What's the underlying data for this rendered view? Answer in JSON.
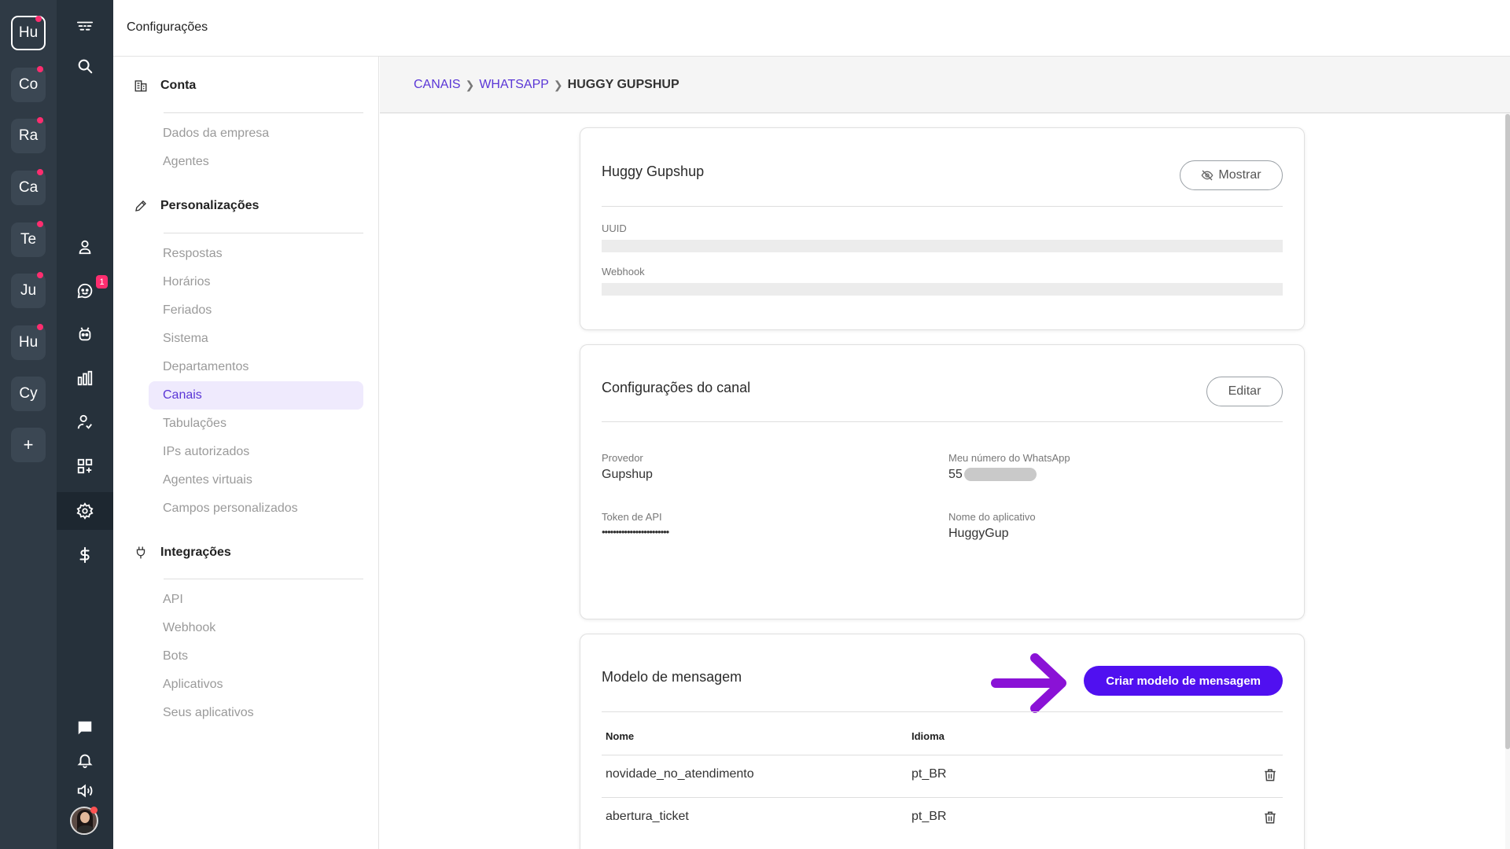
{
  "workspaces": [
    {
      "label": "Hu",
      "active": true
    },
    {
      "label": "Co"
    },
    {
      "label": "Ra"
    },
    {
      "label": "Ca"
    },
    {
      "label": "Te"
    },
    {
      "label": "Ju"
    },
    {
      "label": "Hu"
    },
    {
      "label": "Cy"
    },
    {
      "label": "+"
    }
  ],
  "nav": {
    "chat_badge": "1",
    "icons": [
      "logo-icon",
      "search-icon",
      "contacts-icon",
      "chat-icon",
      "bot-icon",
      "reports-icon",
      "agents-icon",
      "apps-icon",
      "settings-icon",
      "billing-icon",
      "messages-icon",
      "bell-icon",
      "sound-icon"
    ]
  },
  "topbar": {
    "title": "Configurações"
  },
  "sidebar": {
    "sections": [
      {
        "title": "Conta",
        "icon": "building-icon",
        "items": [
          "Dados da empresa",
          "Agentes"
        ]
      },
      {
        "title": "Personalizações",
        "icon": "pencil-icon",
        "items": [
          "Respostas",
          "Horários",
          "Feriados",
          "Sistema",
          "Departamentos",
          "Canais",
          "Tabulações",
          "IPs autorizados",
          "Agentes virtuais",
          "Campos personalizados"
        ]
      },
      {
        "title": "Integrações",
        "icon": "plug-icon",
        "items": [
          "API",
          "Webhook",
          "Bots",
          "Aplicativos",
          "Seus aplicativos"
        ]
      }
    ],
    "active_item": "Canais"
  },
  "breadcrumb": {
    "items": [
      "CANAIS",
      "WHATSAPP"
    ],
    "current": "HUGGY GUPSHUP"
  },
  "channel_card": {
    "title": "Huggy Gupshup",
    "show_button": "Mostrar",
    "uuid_label": "UUID",
    "webhook_label": "Webhook"
  },
  "config_card": {
    "title": "Configurações do canal",
    "edit_button": "Editar",
    "provider_label": "Provedor",
    "provider_value": "Gupshup",
    "whatsapp_label": "Meu número do WhatsApp",
    "whatsapp_value": "55",
    "token_label": "Token de API",
    "token_value": "••••••••••••••••••••••••",
    "app_label": "Nome do aplicativo",
    "app_value": "HuggyGup"
  },
  "templates_card": {
    "title": "Modelo de mensagem",
    "create_button": "Criar modelo de mensagem",
    "columns": [
      "Nome",
      "Idioma"
    ],
    "rows": [
      {
        "name": "novidade_no_atendimento",
        "language": "pt_BR"
      },
      {
        "name": "abertura_ticket",
        "language": "pt_BR"
      }
    ]
  },
  "colors": {
    "accent": "#5010f0",
    "arrow": "#8a12d6",
    "badge": "#ff2d6f",
    "rail": "#2f3a45"
  }
}
